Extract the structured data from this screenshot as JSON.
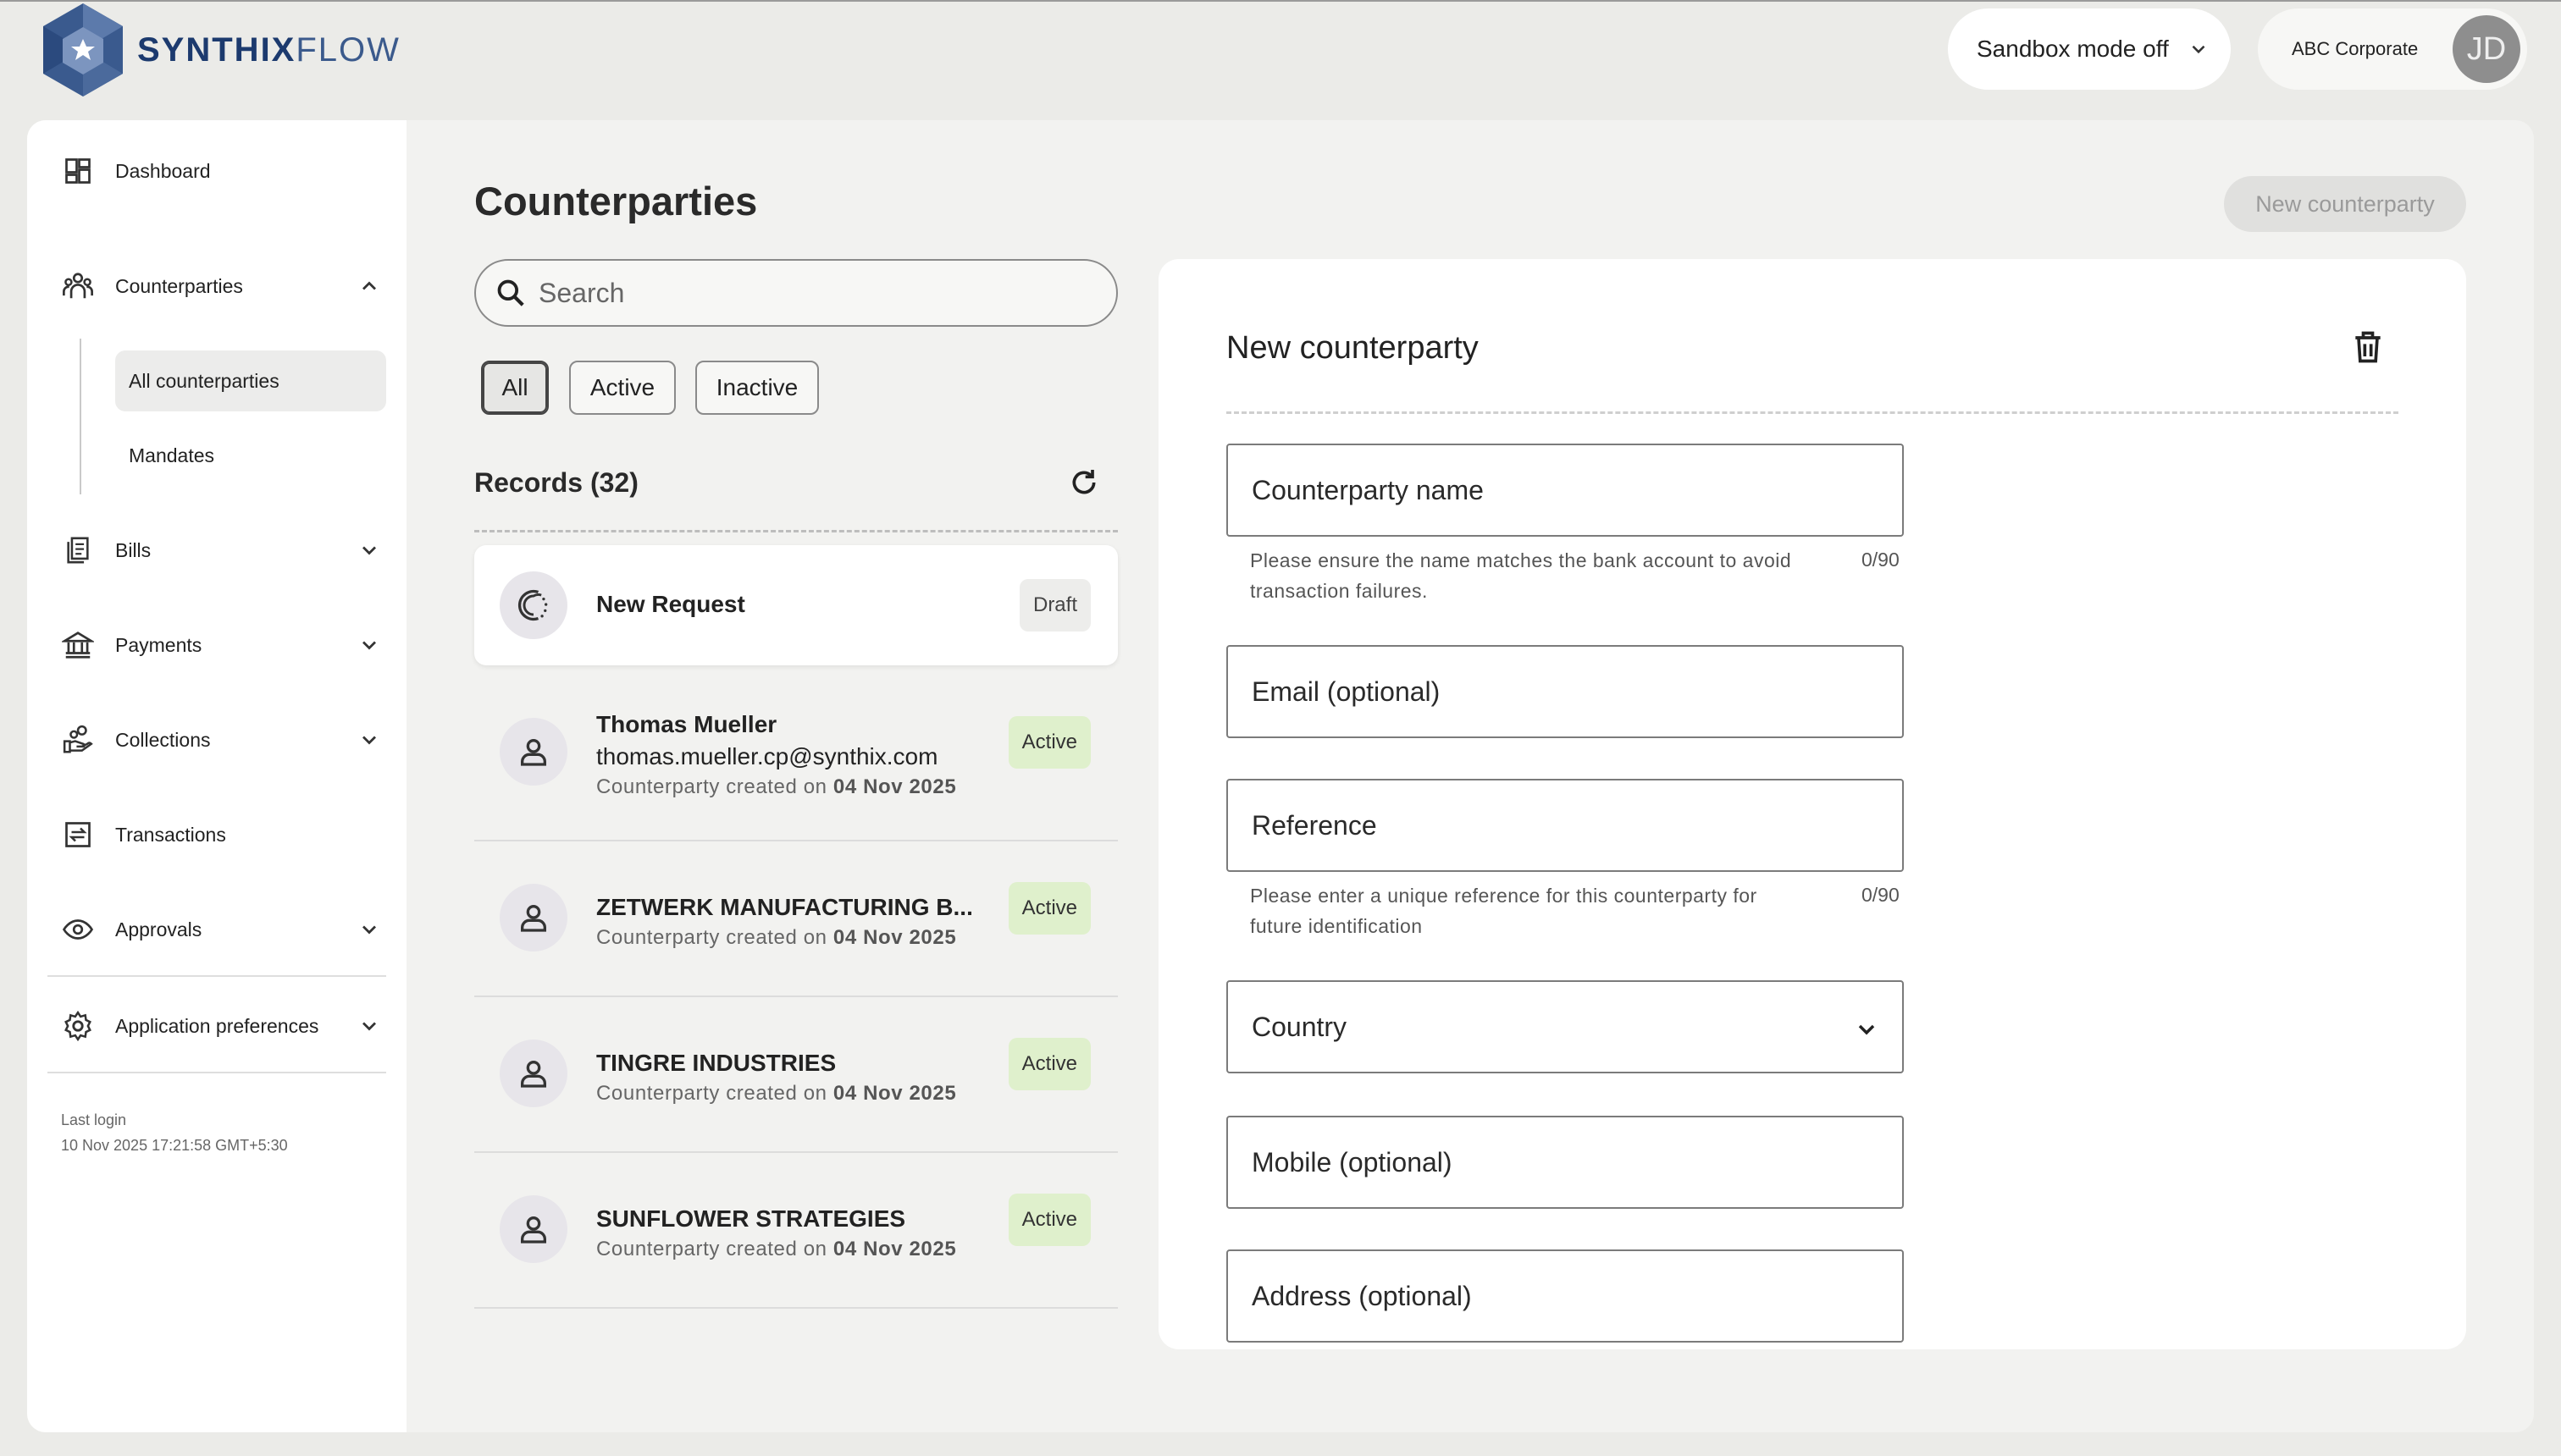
{
  "brand": {
    "name_bold": "SYNTHIX",
    "name_light": "FLOW"
  },
  "topbar": {
    "sandbox_label": "Sandbox mode off",
    "org_name": "ABC Corporate",
    "avatar_initials": "JD"
  },
  "sidebar": {
    "items": [
      {
        "label": "Dashboard",
        "icon": "dashboard-icon"
      },
      {
        "label": "Counterparties",
        "icon": "people-icon",
        "expanded": true
      },
      {
        "label": "Bills",
        "icon": "bills-icon"
      },
      {
        "label": "Payments",
        "icon": "bank-icon"
      },
      {
        "label": "Collections",
        "icon": "hand-coins-icon"
      },
      {
        "label": "Transactions",
        "icon": "transfer-icon"
      },
      {
        "label": "Approvals",
        "icon": "eye-icon"
      },
      {
        "label": "Application preferences",
        "icon": "gear-icon"
      }
    ],
    "sub_items": [
      {
        "label": "All counterparties",
        "active": true
      },
      {
        "label": "Mandates",
        "active": false
      }
    ],
    "last_login_label": "Last login",
    "last_login_value": "10 Nov 2025 17:21:58 GMT+5:30"
  },
  "main": {
    "title": "Counterparties",
    "new_button": "New counterparty",
    "search_placeholder": "Search",
    "filters": [
      "All",
      "Active",
      "Inactive"
    ],
    "selected_filter": "All",
    "records_label": "Records (32)",
    "list": [
      {
        "name": "New Request",
        "status": "Draft",
        "type": "draft"
      },
      {
        "name": "Thomas Mueller",
        "email": "thomas.mueller.cp@synthix.com",
        "meta_prefix": "Counterparty created on",
        "meta_date": "04 Nov 2025",
        "status": "Active"
      },
      {
        "name": "ZETWERK MANUFACTURING B...",
        "meta_prefix": "Counterparty created on",
        "meta_date": "04 Nov 2025",
        "status": "Active"
      },
      {
        "name": "TINGRE INDUSTRIES",
        "meta_prefix": "Counterparty created on",
        "meta_date": "04 Nov 2025",
        "status": "Active"
      },
      {
        "name": "SUNFLOWER STRATEGIES",
        "meta_prefix": "Counterparty created on",
        "meta_date": "04 Nov 2025",
        "status": "Active"
      }
    ]
  },
  "form": {
    "title": "New counterparty",
    "fields": {
      "name": "Counterparty name",
      "name_help": "Please ensure the name matches the bank account to avoid transaction failures.",
      "name_counter": "0/90",
      "email": "Email (optional)",
      "reference": "Reference",
      "reference_help": "Please enter a unique reference for this counterparty for future identification",
      "reference_counter": "0/90",
      "country": "Country",
      "mobile": "Mobile (optional)",
      "address": "Address (optional)"
    }
  },
  "colors": {
    "brand": "#1c3a6e",
    "active_badge": "#dff0cc",
    "draft_badge": "#ededeb",
    "background": "#ebebe8"
  }
}
